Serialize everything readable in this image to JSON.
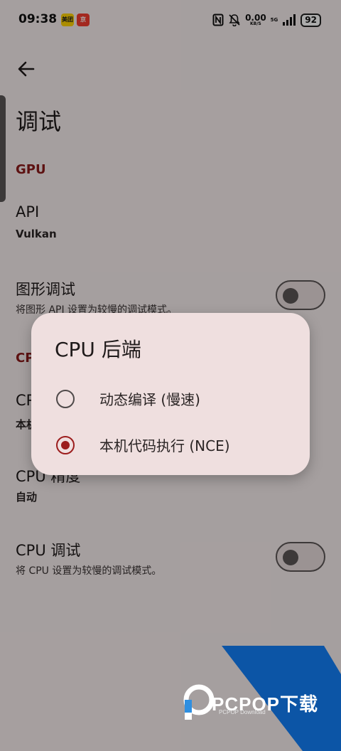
{
  "status_bar": {
    "time": "09:38",
    "app_badge_1": "美团",
    "app_badge_2": "京",
    "net_speed_value": "0.00",
    "net_speed_unit": "KB/S",
    "signal_type": "5G",
    "battery": "92",
    "icons": [
      "nfc-icon",
      "mute-icon",
      "signal-icon"
    ]
  },
  "header": {
    "back_icon": "arrow-left-icon",
    "title": "调试"
  },
  "gpu_section": {
    "label": "GPU",
    "api_title": "API",
    "api_value": "Vulkan",
    "graphics_debug_title": "图形调试",
    "graphics_debug_desc": "将图形 API 设置为较慢的调试模式。",
    "graphics_debug_on": false
  },
  "cpu_section": {
    "label_partial": "CP",
    "backend_title_partial": "CP",
    "backend_value_partial": "本机",
    "accuracy_title": "CPU 精度",
    "accuracy_value": "自动",
    "cpu_debug_title": "CPU 调试",
    "cpu_debug_desc": "将 CPU 设置为较慢的调试模式。",
    "cpu_debug_on": false
  },
  "dialog": {
    "title": "CPU 后端",
    "options": [
      {
        "label": "动态编译 (慢速)",
        "selected": false
      },
      {
        "label": "本机代码执行 (NCE)",
        "selected": true
      }
    ]
  },
  "watermark": {
    "text": "PCPOP下载",
    "sub": "PCPOP Download"
  },
  "colors": {
    "accent": "#9c1d1d",
    "section_label": "#8b1a1a",
    "background": "#f7eded",
    "dialog": "#efdfdf",
    "watermark_blue": "#0c55a6"
  }
}
